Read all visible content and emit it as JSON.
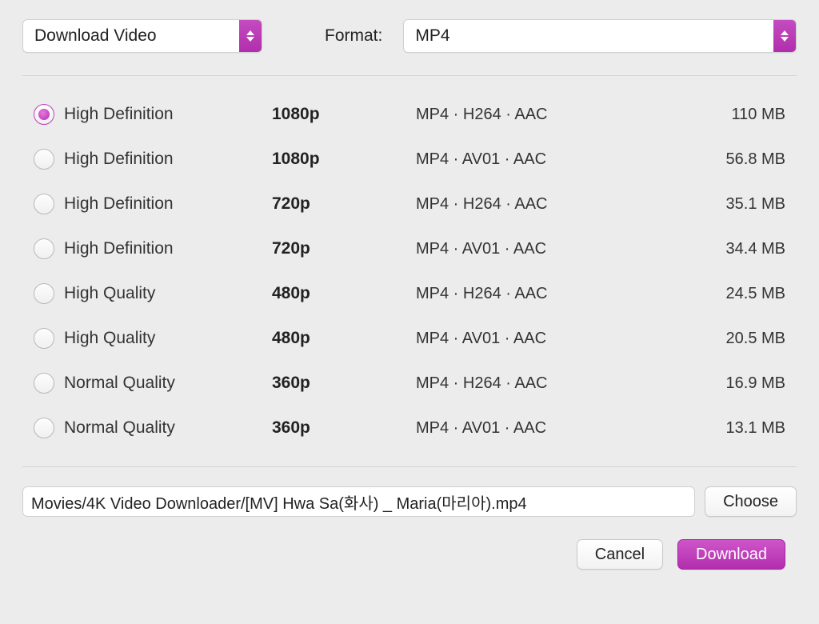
{
  "header": {
    "action_label": "Download Video",
    "format_field_label": "Format:",
    "format_value": "MP4"
  },
  "options": [
    {
      "quality": "High Definition",
      "resolution": "1080p",
      "codec": "MP4 · H264 · AAC",
      "size": "110 MB",
      "selected": true
    },
    {
      "quality": "High Definition",
      "resolution": "1080p",
      "codec": "MP4 · AV01 · AAC",
      "size": "56.8 MB",
      "selected": false
    },
    {
      "quality": "High Definition",
      "resolution": "720p",
      "codec": "MP4 · H264 · AAC",
      "size": "35.1 MB",
      "selected": false
    },
    {
      "quality": "High Definition",
      "resolution": "720p",
      "codec": "MP4 · AV01 · AAC",
      "size": "34.4 MB",
      "selected": false
    },
    {
      "quality": "High Quality",
      "resolution": "480p",
      "codec": "MP4 · H264 · AAC",
      "size": "24.5 MB",
      "selected": false
    },
    {
      "quality": "High Quality",
      "resolution": "480p",
      "codec": "MP4 · AV01 · AAC",
      "size": "20.5 MB",
      "selected": false
    },
    {
      "quality": "Normal Quality",
      "resolution": "360p",
      "codec": "MP4 · H264 · AAC",
      "size": "16.9 MB",
      "selected": false
    },
    {
      "quality": "Normal Quality",
      "resolution": "360p",
      "codec": "MP4 · AV01 · AAC",
      "size": "13.1 MB",
      "selected": false
    }
  ],
  "path": {
    "value": "Movies/4K Video Downloader/[MV] Hwa Sa(화사) _ Maria(마리아).mp4",
    "choose_label": "Choose"
  },
  "buttons": {
    "cancel": "Cancel",
    "download": "Download"
  }
}
